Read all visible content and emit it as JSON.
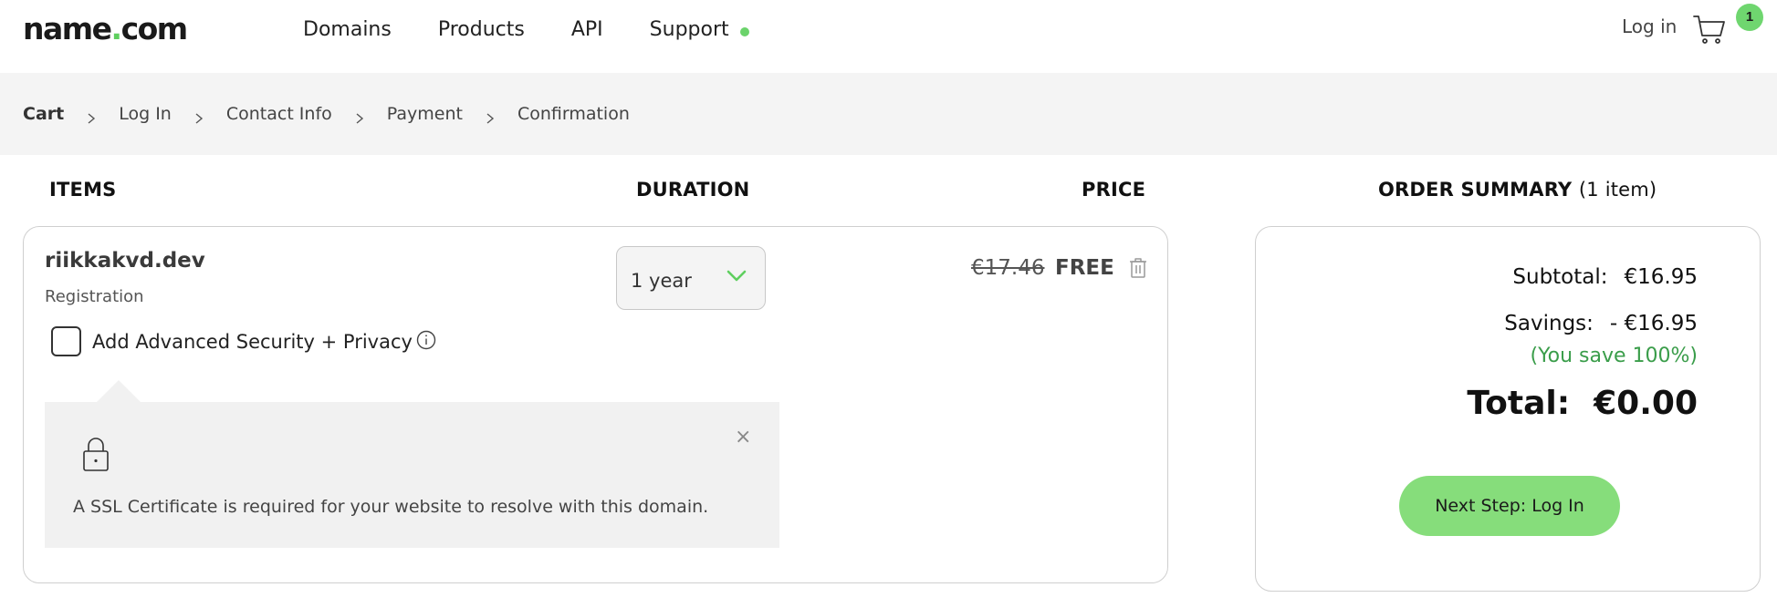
{
  "header": {
    "logo_name": "name",
    "logo_dot": ".",
    "logo_tld": "com",
    "nav": [
      "Domains",
      "Products",
      "API",
      "Support"
    ],
    "support_status_color": "#6bd36b",
    "login_label": "Log in",
    "cart_icon": "shopping-cart-icon",
    "cart_count": "1"
  },
  "breadcrumb": {
    "steps": [
      "Cart",
      "Log In",
      "Contact Info",
      "Payment",
      "Confirmation"
    ],
    "active_step": "Cart",
    "separator_icon": "chevron-right-icon"
  },
  "columns": {
    "items": "ITEMS",
    "duration": "DURATION",
    "price": "PRICE",
    "summary": "ORDER SUMMARY",
    "summary_count": "(1 item)"
  },
  "cart_item": {
    "domain": "riikkakvd.dev",
    "type": "Registration",
    "duration": "1 year",
    "old_price": "€17.46",
    "new_price": "FREE",
    "delete_icon": "trash-icon",
    "addon_label": "Add Advanced Security + Privacy",
    "addon_checked": false,
    "info_icon": "info-icon",
    "tip": {
      "icon": "lock-icon",
      "close": "×",
      "text": "A SSL Certificate is required for your website to resolve with this domain."
    }
  },
  "summary": {
    "subtotal_label": "Subtotal:",
    "subtotal_value": "€16.95",
    "savings_label": "Savings:",
    "savings_value": "- €16.95",
    "savings_percent": "(You save 100%)",
    "total_label": "Total:",
    "total_value": "€0.00",
    "next_button": "Next Step: Log In"
  },
  "colors": {
    "brand_green": "#5fcf5f",
    "button_green": "#86dd7b",
    "savings_green": "#3a9d4a",
    "breadcrumb_bg": "#f4f4f4"
  }
}
